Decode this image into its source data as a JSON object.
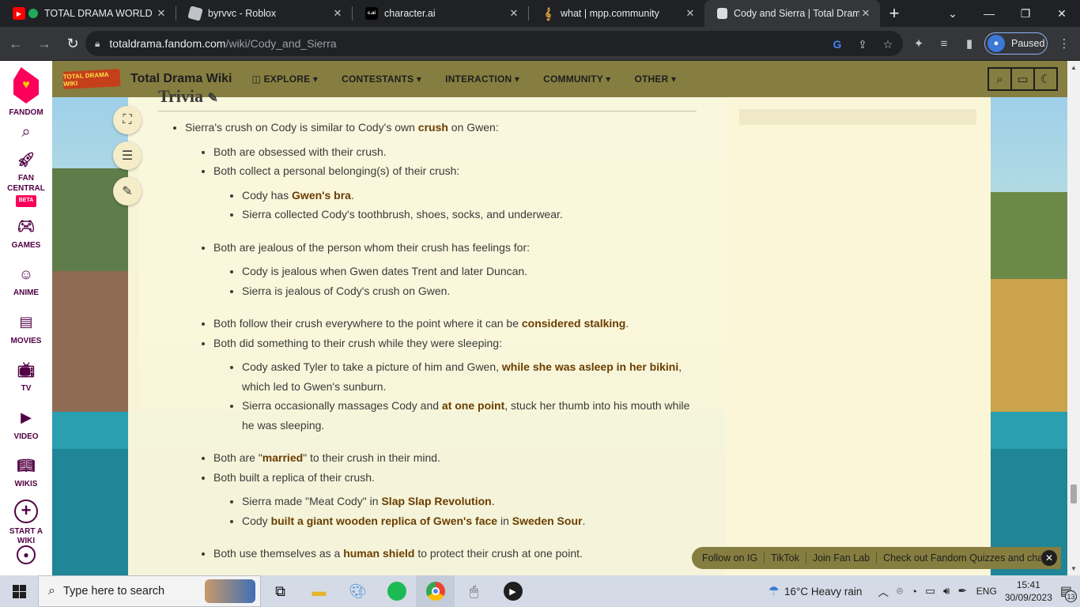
{
  "tabs": [
    {
      "title": "TOTAL DRAMA WORLD T",
      "favicon": "youtube-icon"
    },
    {
      "title": "byrvvc - Roblox",
      "favicon": "roblox-icon"
    },
    {
      "title": "character.ai",
      "favicon": "cai-icon",
      "favicon_text": "c.ai"
    },
    {
      "title": "what | mpp.community",
      "favicon": "music-note-icon"
    },
    {
      "title": "Cody and Sierra | Total Dram",
      "favicon": "page-icon",
      "active": true
    }
  ],
  "address": {
    "host": "totaldrama.fandom.com",
    "path": "/wiki/Cody_and_Sierra",
    "profile_status": "Paused"
  },
  "fandom_sidebar": {
    "brand": "FANDOM",
    "items": [
      {
        "label": "FAN\nCENTRAL",
        "badge": "BETA",
        "icon": "rocket-icon"
      },
      {
        "label": "GAMES",
        "icon": "gamepad-icon"
      },
      {
        "label": "ANIME",
        "icon": "anime-icon"
      },
      {
        "label": "MOVIES",
        "icon": "clapper-icon"
      },
      {
        "label": "TV",
        "icon": "tv-icon"
      },
      {
        "label": "VIDEO",
        "icon": "video-icon"
      },
      {
        "label": "WIKIS",
        "icon": "book-icon"
      },
      {
        "label": "START A\nWIKI",
        "icon": "plus-circle-icon"
      }
    ]
  },
  "wiki_header": {
    "logo_text": "TOTAL DRAMA WIKI",
    "title": "Total Drama Wiki",
    "nav": [
      "EXPLORE",
      "CONTESTANTS",
      "INTERACTION",
      "COMMUNITY",
      "OTHER"
    ]
  },
  "article": {
    "heading": "Trivia",
    "items": {
      "i1": "Sierra's crush on Cody is similar to Cody's own ",
      "i1_link": "crush",
      "i1_tail": " on Gwen:",
      "a1": "Both are obsessed with their crush.",
      "a2": "Both collect a personal belonging(s) of their crush:",
      "a2a_pre": "Cody has ",
      "a2a_link": "Gwen's bra",
      "a2a_tail": ".",
      "a2b": "Sierra collected Cody's toothbrush, shoes, socks, and underwear.",
      "a3": "Both are jealous of the person whom their crush has feelings for:",
      "a3a": "Cody is jealous when Gwen dates Trent and later Duncan.",
      "a3b": "Sierra is jealous of Cody's crush on Gwen.",
      "a4_pre": "Both follow their crush everywhere to the point where it can be ",
      "a4_link": "considered stalking",
      "a4_tail": ".",
      "a5": "Both did something to their crush while they were sleeping:",
      "a5a_pre": "Cody asked Tyler to take a picture of him and Gwen, ",
      "a5a_link": "while she was asleep in her bikini",
      "a5a_tail": ", which led to Gwen's sunburn.",
      "a5b_pre": "Sierra occasionally massages Cody and ",
      "a5b_link": "at one point",
      "a5b_tail": ", stuck her thumb into his mouth while he was sleeping.",
      "a6_pre": "Both are \"",
      "a6_link": "married",
      "a6_tail": "\" to their crush in their mind.",
      "a7": "Both built a replica of their crush.",
      "a7a_pre": "Sierra made \"Meat Cody\" in ",
      "a7a_link": "Slap Slap Revolution",
      "a7a_tail": ".",
      "a7b_pre": "Cody ",
      "a7b_link": "built a giant wooden replica of Gwen's face",
      "a7b_mid": " in ",
      "a7b_link2": "Sweden Sour",
      "a7b_tail": ".",
      "a8_pre": "Both use themselves as a ",
      "a8_link": "human shield",
      "a8_tail": " to protect their crush at one point."
    }
  },
  "fan_bar": {
    "items": [
      "Follow on IG",
      "TikTok",
      "Join Fan Lab",
      "Check out Fandom Quizzes and cha"
    ]
  },
  "taskbar": {
    "search_placeholder": "Type here to search",
    "weather": "16°C  Heavy rain",
    "lang": "ENG",
    "time": "15:41",
    "date": "30/09/2023",
    "notifications": "13"
  },
  "colors": {
    "wiki_header": "#867e40",
    "link": "#6a3d00",
    "fandom_pink": "#fa005a"
  }
}
